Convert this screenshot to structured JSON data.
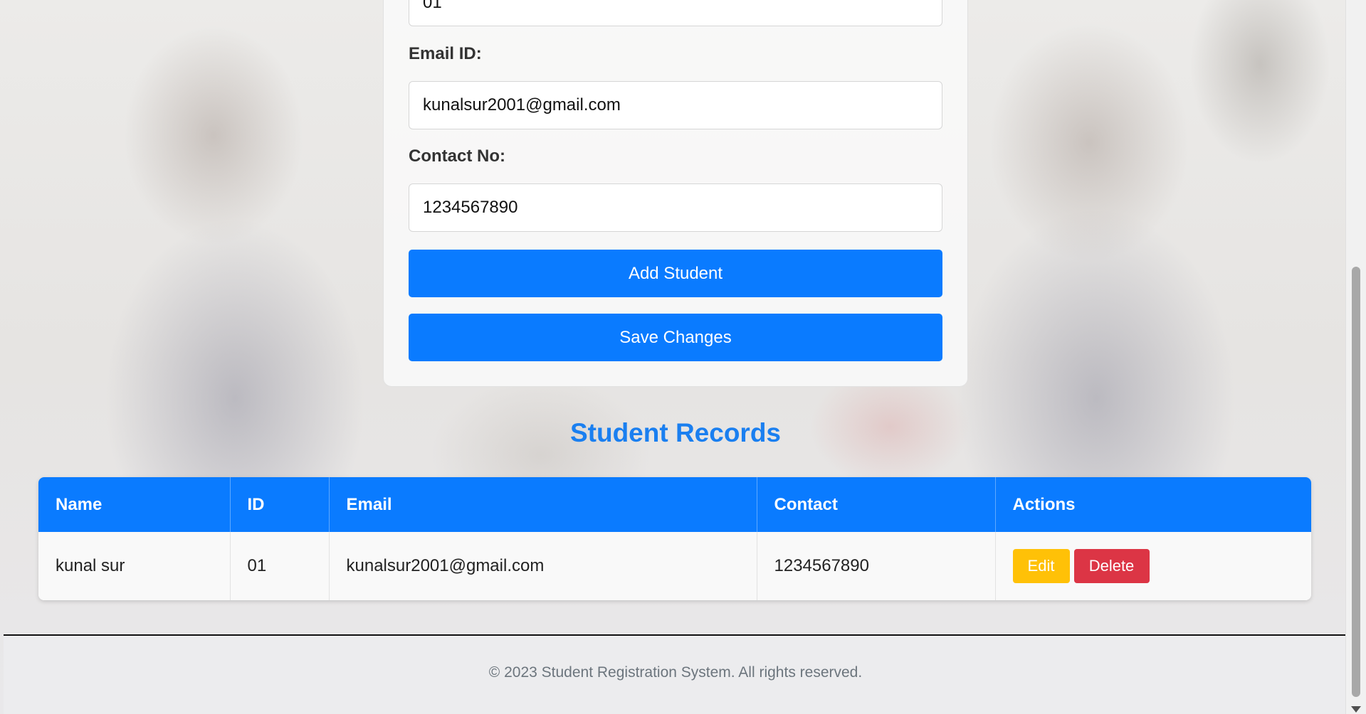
{
  "form": {
    "id_value": "01",
    "email_label": "Email ID:",
    "email_value": "kunalsur2001@gmail.com",
    "contact_label": "Contact No:",
    "contact_value": "1234567890",
    "add_button": "Add Student",
    "save_button": "Save Changes"
  },
  "records": {
    "title": "Student Records",
    "columns": [
      "Name",
      "ID",
      "Email",
      "Contact",
      "Actions"
    ],
    "rows": [
      {
        "name": "kunal sur",
        "id": "01",
        "email": "kunalsur2001@gmail.com",
        "contact": "1234567890",
        "edit_label": "Edit",
        "delete_label": "Delete"
      }
    ]
  },
  "footer": {
    "text": "© 2023 Student Registration System. All rights reserved."
  },
  "colors": {
    "primary": "#0a7bff",
    "title": "#1a7ff0",
    "edit": "#ffc107",
    "delete": "#dc3545"
  }
}
